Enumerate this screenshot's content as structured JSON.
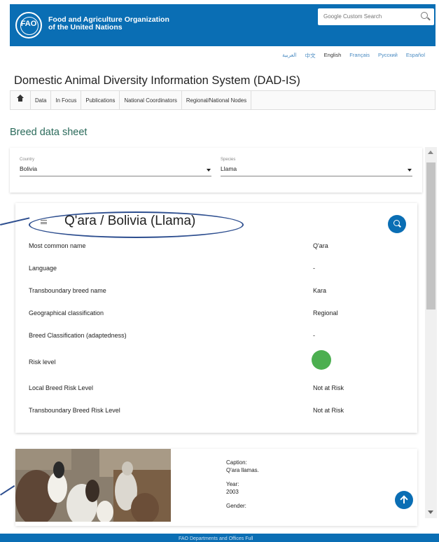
{
  "header": {
    "logo_text": "FAO",
    "org_line1": "Food and Agriculture Organization",
    "org_line2": "of the United Nations",
    "search_placeholder": "Google Custom Search"
  },
  "languages": [
    "العربية",
    "中文",
    "English",
    "Français",
    "Русский",
    "Español"
  ],
  "system_title": "Domestic Animal Diversity Information System (DAD-IS)",
  "nav": [
    "Data",
    "In Focus",
    "Publications",
    "National Coordinators",
    "Regional/National Nodes"
  ],
  "page_title": "Breed data sheet",
  "filters": {
    "country": {
      "label": "Country",
      "value": "Bolivia"
    },
    "species": {
      "label": "Species",
      "value": "Llama"
    }
  },
  "breed": {
    "title": "Q'ara / Bolivia (Llama)",
    "rows": [
      {
        "key": "Most common name",
        "value": "Q'ara"
      },
      {
        "key": "Language",
        "value": "-"
      },
      {
        "key": "Transboundary breed name",
        "value": "Kara"
      },
      {
        "key": "Geographical classification",
        "value": "Regional"
      },
      {
        "key": "Breed Classification (adaptedness)",
        "value": "-"
      },
      {
        "key": "Risk level",
        "value": ""
      },
      {
        "key": "Local Breed Risk Level",
        "value": "Not at Risk"
      },
      {
        "key": "Transboundary Breed Risk Level",
        "value": "Not at Risk"
      }
    ],
    "risk_color": "#4caf50"
  },
  "photo": {
    "caption_label": "Caption:",
    "caption": "Q'ara llamas.",
    "year_label": "Year:",
    "year": "2003",
    "gender_label": "Gender:"
  },
  "footer": {
    "text": "FAO Departments and Offices                              Full"
  },
  "colors": {
    "brand_blue": "#0a6eb4",
    "annotation": "#2d4e8f"
  }
}
